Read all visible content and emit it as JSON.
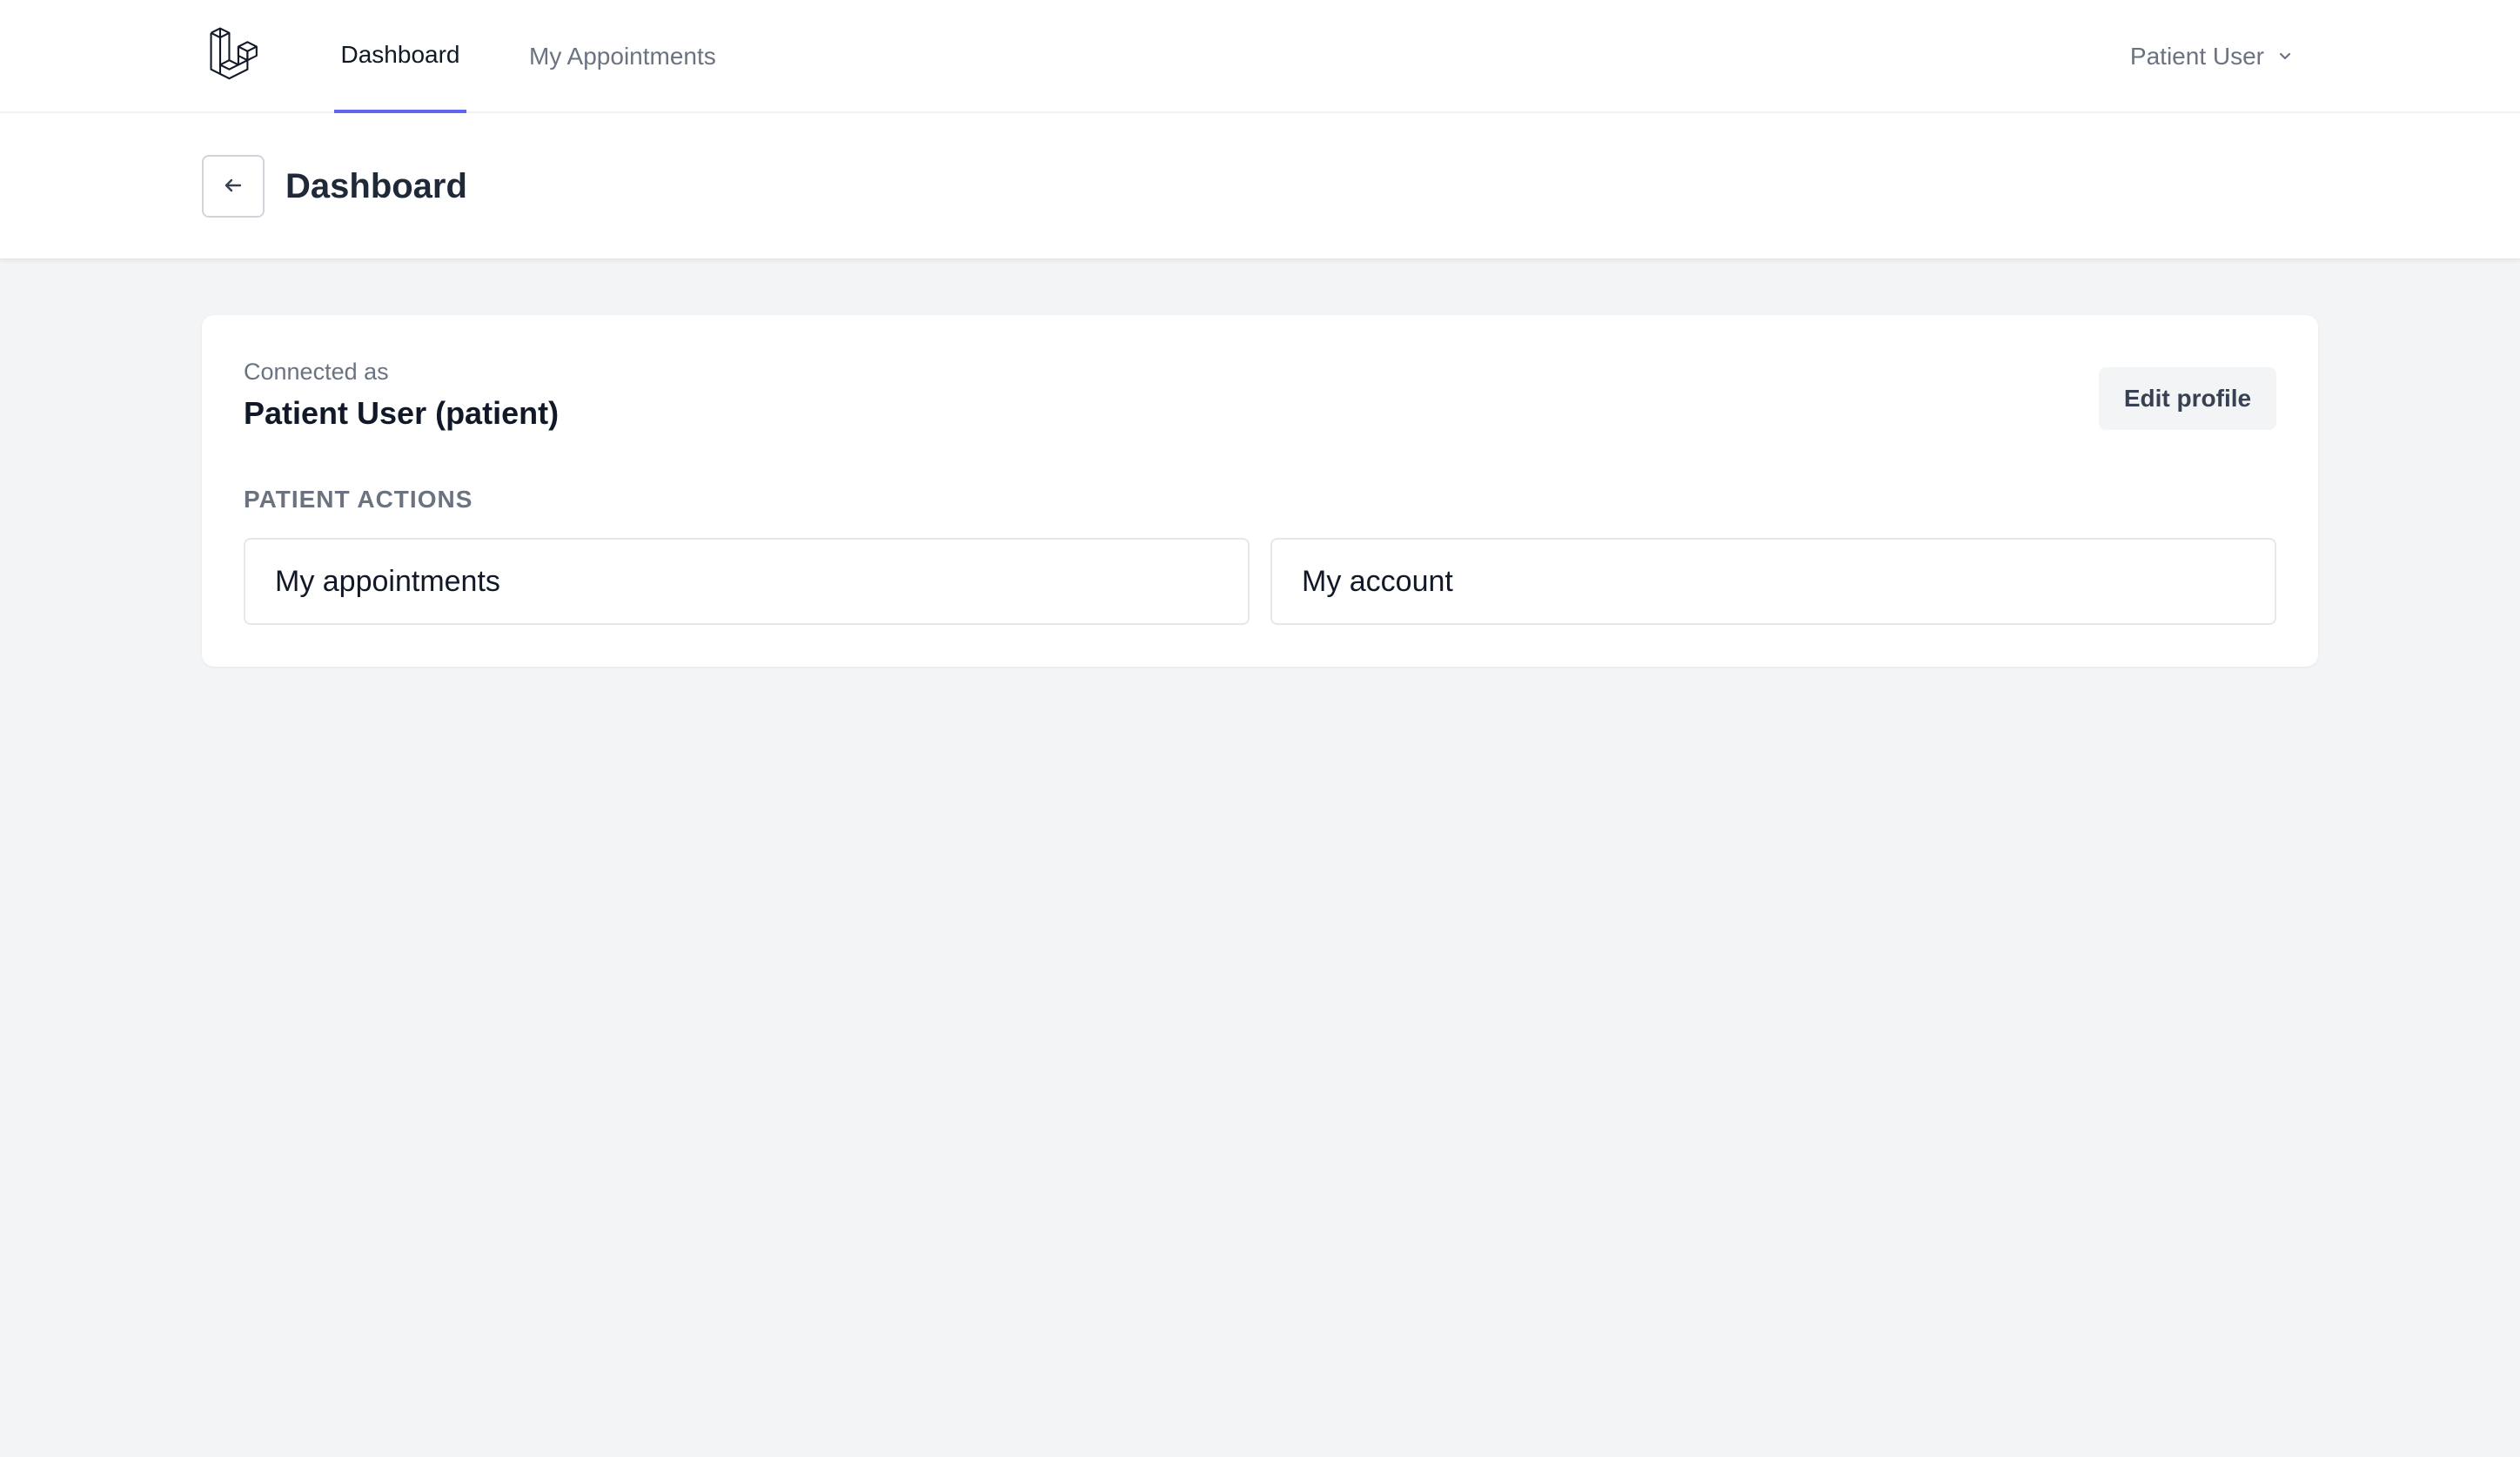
{
  "nav": {
    "logo_icon": "laravel-logo-icon",
    "links": [
      {
        "label": "Dashboard",
        "active": true
      },
      {
        "label": "My Appointments",
        "active": false
      }
    ],
    "user_menu": {
      "label": "Patient User",
      "icon": "chevron-down-icon"
    },
    "accent_color": "#6366f1"
  },
  "header": {
    "back_icon": "arrow-left-icon",
    "title": "Dashboard"
  },
  "profile_card": {
    "connected_label": "Connected as",
    "user_name": "Patient User (patient)",
    "edit_button": "Edit profile",
    "section_heading": "PATIENT ACTIONS",
    "actions": [
      {
        "label": "My appointments"
      },
      {
        "label": "My account"
      }
    ]
  }
}
